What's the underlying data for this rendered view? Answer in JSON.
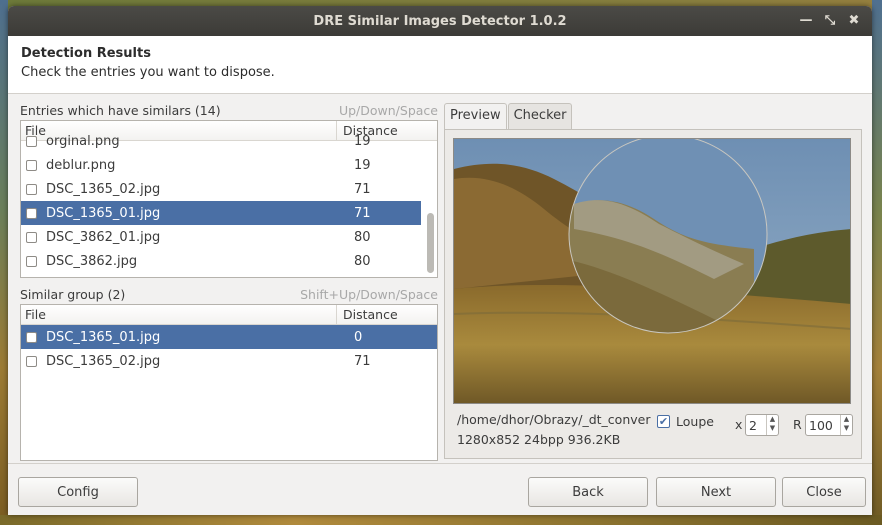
{
  "window": {
    "title": "DRE Similar Images Detector 1.0.2"
  },
  "header": {
    "title": "Detection Results",
    "subtitle": "Check the entries you want to dispose."
  },
  "entries": {
    "label": "Entries which have similars (14)",
    "hint": "Up/Down/Space",
    "col_file": "File",
    "col_distance": "Distance",
    "rows": [
      {
        "file": "orginal.png",
        "distance": "19",
        "selected": false
      },
      {
        "file": "deblur.png",
        "distance": "19",
        "selected": false
      },
      {
        "file": "DSC_1365_02.jpg",
        "distance": "71",
        "selected": false
      },
      {
        "file": "DSC_1365_01.jpg",
        "distance": "71",
        "selected": true
      },
      {
        "file": "DSC_3862_01.jpg",
        "distance": "80",
        "selected": false
      },
      {
        "file": "DSC_3862.jpg",
        "distance": "80",
        "selected": false
      }
    ]
  },
  "group": {
    "label": "Similar group (2)",
    "hint": "Shift+Up/Down/Space",
    "col_file": "File",
    "col_distance": "Distance",
    "rows": [
      {
        "file": "DSC_1365_01.jpg",
        "distance": "0",
        "selected": true
      },
      {
        "file": "DSC_1365_02.jpg",
        "distance": "71",
        "selected": false
      }
    ]
  },
  "tabs": [
    "Preview",
    "Checker"
  ],
  "preview": {
    "path": "/home/dhor/Obrazy/_dt_conver",
    "meta": "1280x852 24bpp 936.2KB",
    "loupe_label": "Loupe",
    "loupe_checked": true,
    "x_label": "x",
    "x_value": "2",
    "r_label": "R",
    "r_value": "100"
  },
  "footer": {
    "config": "Config",
    "back": "Back",
    "next": "Next",
    "close": "Close"
  }
}
